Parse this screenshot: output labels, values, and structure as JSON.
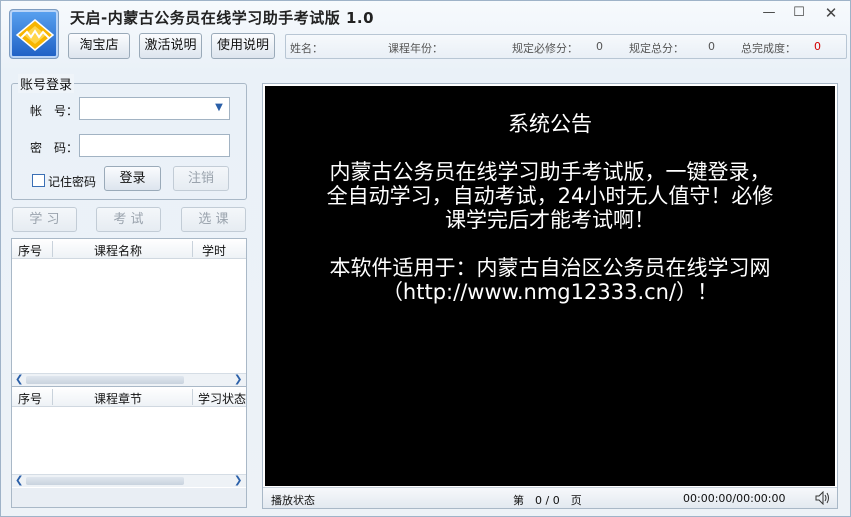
{
  "app": {
    "title": "天启-内蒙古公务员在线学习助手考试版 1.0",
    "logo_icon": "diamond-logo-icon"
  },
  "window_controls": {
    "minimize": "—",
    "maximize": "☐",
    "close": "✕"
  },
  "toolbar": {
    "taobao_label": "淘宝店",
    "activate_label": "激活说明",
    "usage_label": "使用说明"
  },
  "infobar": {
    "name_label": "姓名：",
    "name_value": "",
    "year_label": "课程年份：",
    "year_value": "",
    "required_label": "规定必修分：",
    "required_value": "0",
    "total_label": "规定总分：",
    "total_value": "0",
    "completion_label": "总完成度：",
    "completion_value": "0",
    "completion_color": "#d40000"
  },
  "login": {
    "legend": "账号登录",
    "account_label": "帐　号：",
    "account_value": "",
    "password_label": "密　码：",
    "password_value": "",
    "remember_label": "记住密码",
    "remember_checked": false,
    "login_button": "登录",
    "logout_button": "注销"
  },
  "actions": {
    "study": "学 习",
    "exam": "考 试",
    "select": "选 课"
  },
  "courses_table": {
    "columns": [
      "序号",
      "课程名称",
      "学时"
    ],
    "rows": []
  },
  "chapters_table": {
    "columns": [
      "序号",
      "课程章节",
      "学习状态"
    ],
    "rows": []
  },
  "announcement": {
    "title": "系统公告",
    "lines": [
      "内蒙古公务员在线学习助手考试版，一键登录，",
      "全自动学习，自动考试，24小时无人值守！必修",
      "课学完后才能考试啊！",
      "本软件适用于：内蒙古自治区公务员在线学习网",
      "（http://www.nmg12333.cn/）！"
    ]
  },
  "player_status": {
    "label": "播放状态",
    "page_text": "第　0 / 0　页",
    "time": "00:00:00/00:00:00",
    "speaker_icon": "speaker-icon"
  }
}
